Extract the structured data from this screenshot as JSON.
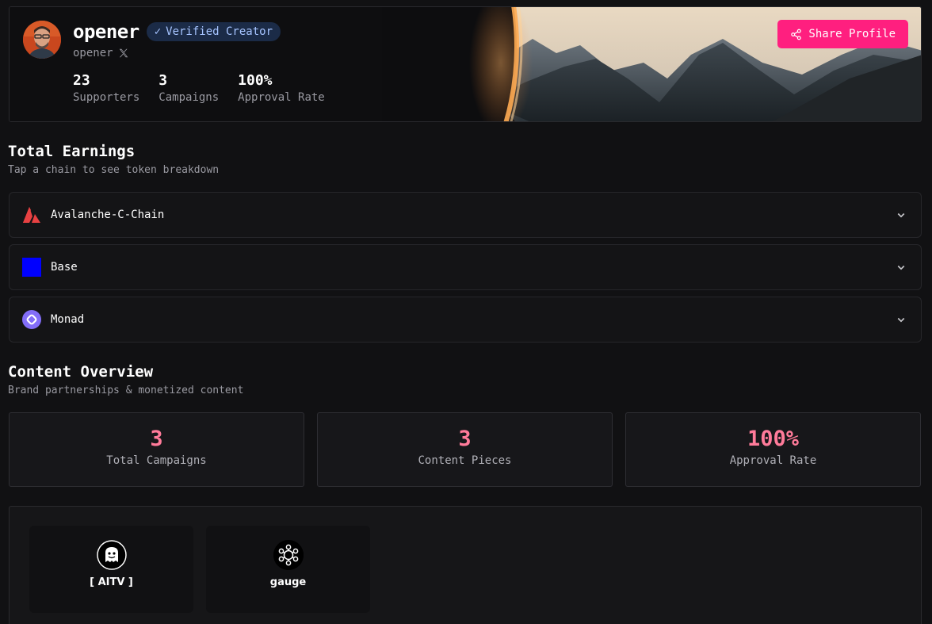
{
  "profile": {
    "name": "opener",
    "verified_label": "Verified Creator",
    "handle": "opener",
    "social_icon": "x-icon",
    "stats": [
      {
        "value": "23",
        "label": "Supporters"
      },
      {
        "value": "3",
        "label": "Campaigns"
      },
      {
        "value": "100%",
        "label": "Approval Rate"
      }
    ],
    "share_label": "Share Profile"
  },
  "earnings": {
    "title": "Total Earnings",
    "subtitle": "Tap a chain to see token breakdown",
    "chains": [
      {
        "name": "Avalanche-C-Chain",
        "icon": "avalanche-icon",
        "color": "#e84142"
      },
      {
        "name": "Base",
        "icon": "base-icon",
        "color": "#0000ff"
      },
      {
        "name": "Monad",
        "icon": "monad-icon",
        "color": "#836ef9"
      }
    ]
  },
  "overview": {
    "title": "Content Overview",
    "subtitle": "Brand partnerships & monetized content",
    "cards": [
      {
        "value": "3",
        "label": "Total Campaigns"
      },
      {
        "value": "3",
        "label": "Content Pieces"
      },
      {
        "value": "100%",
        "label": "Approval Rate"
      }
    ]
  },
  "brands": [
    {
      "name": "[ AITV ]",
      "icon": "aitv-logo-icon"
    },
    {
      "name": "gauge",
      "icon": "gauge-logo-icon"
    }
  ],
  "colors": {
    "accent": "#ff1f7f",
    "stat_value": "#ff7b9a",
    "badge_bg": "#1b2b47",
    "badge_text": "#a6c4ff"
  }
}
